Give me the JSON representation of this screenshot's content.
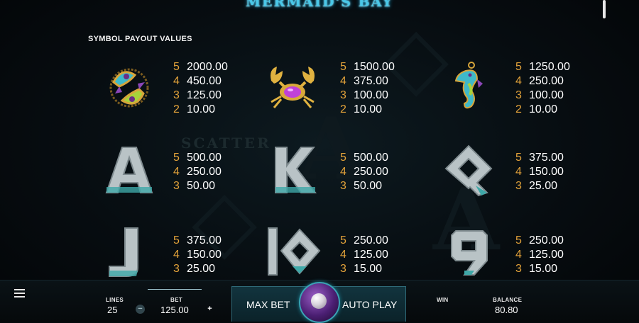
{
  "game": {
    "title": "MERMAID'S BAY",
    "background_text": "SCATTER"
  },
  "paytable": {
    "section_title": "SYMBOL PAYOUT VALUES",
    "symbols": [
      {
        "name": "fish",
        "icon": "fish-icon",
        "payouts": [
          {
            "count": "5",
            "value": "2000.00"
          },
          {
            "count": "4",
            "value": "450.00"
          },
          {
            "count": "3",
            "value": "125.00"
          },
          {
            "count": "2",
            "value": "10.00"
          }
        ]
      },
      {
        "name": "crab",
        "icon": "crab-icon",
        "payouts": [
          {
            "count": "5",
            "value": "1500.00"
          },
          {
            "count": "4",
            "value": "375.00"
          },
          {
            "count": "3",
            "value": "100.00"
          },
          {
            "count": "2",
            "value": "10.00"
          }
        ]
      },
      {
        "name": "seahorse",
        "icon": "seahorse-icon",
        "payouts": [
          {
            "count": "5",
            "value": "1250.00"
          },
          {
            "count": "4",
            "value": "250.00"
          },
          {
            "count": "3",
            "value": "100.00"
          },
          {
            "count": "2",
            "value": "10.00"
          }
        ]
      },
      {
        "name": "A",
        "icon": "letter-a-icon",
        "glyph": "A",
        "payouts": [
          {
            "count": "5",
            "value": "500.00"
          },
          {
            "count": "4",
            "value": "250.00"
          },
          {
            "count": "3",
            "value": "50.00"
          }
        ]
      },
      {
        "name": "K",
        "icon": "letter-k-icon",
        "glyph": "K",
        "payouts": [
          {
            "count": "5",
            "value": "500.00"
          },
          {
            "count": "4",
            "value": "250.00"
          },
          {
            "count": "3",
            "value": "50.00"
          }
        ]
      },
      {
        "name": "Q",
        "icon": "letter-q-icon",
        "glyph": "Q",
        "payouts": [
          {
            "count": "5",
            "value": "375.00"
          },
          {
            "count": "4",
            "value": "150.00"
          },
          {
            "count": "3",
            "value": "25.00"
          }
        ]
      },
      {
        "name": "J",
        "icon": "letter-j-icon",
        "glyph": "J",
        "payouts": [
          {
            "count": "5",
            "value": "375.00"
          },
          {
            "count": "4",
            "value": "150.00"
          },
          {
            "count": "3",
            "value": "25.00"
          }
        ]
      },
      {
        "name": "10",
        "icon": "number-10-icon",
        "glyph": "10",
        "payouts": [
          {
            "count": "5",
            "value": "250.00"
          },
          {
            "count": "4",
            "value": "125.00"
          },
          {
            "count": "3",
            "value": "15.00"
          }
        ]
      },
      {
        "name": "9",
        "icon": "number-9-icon",
        "glyph": "9",
        "payouts": [
          {
            "count": "5",
            "value": "250.00"
          },
          {
            "count": "4",
            "value": "125.00"
          },
          {
            "count": "3",
            "value": "15.00"
          }
        ]
      }
    ]
  },
  "controls": {
    "menu_icon": "hamburger-menu-icon",
    "lines_label": "LINES",
    "lines_value": "25",
    "bet_label": "BET",
    "bet_value": "125.00",
    "minus_symbol": "−",
    "plus_symbol": "+",
    "max_bet_label": "MAX BET",
    "spin_icon": "pearl-spin-icon",
    "auto_play_label": "AUTO PLAY",
    "win_label": "WIN",
    "balance_label": "BALANCE",
    "balance_value": "80.80"
  },
  "colors": {
    "payout_count": "#e2a23a",
    "title_glow": "#49c8e8",
    "panel": "#12343e"
  }
}
